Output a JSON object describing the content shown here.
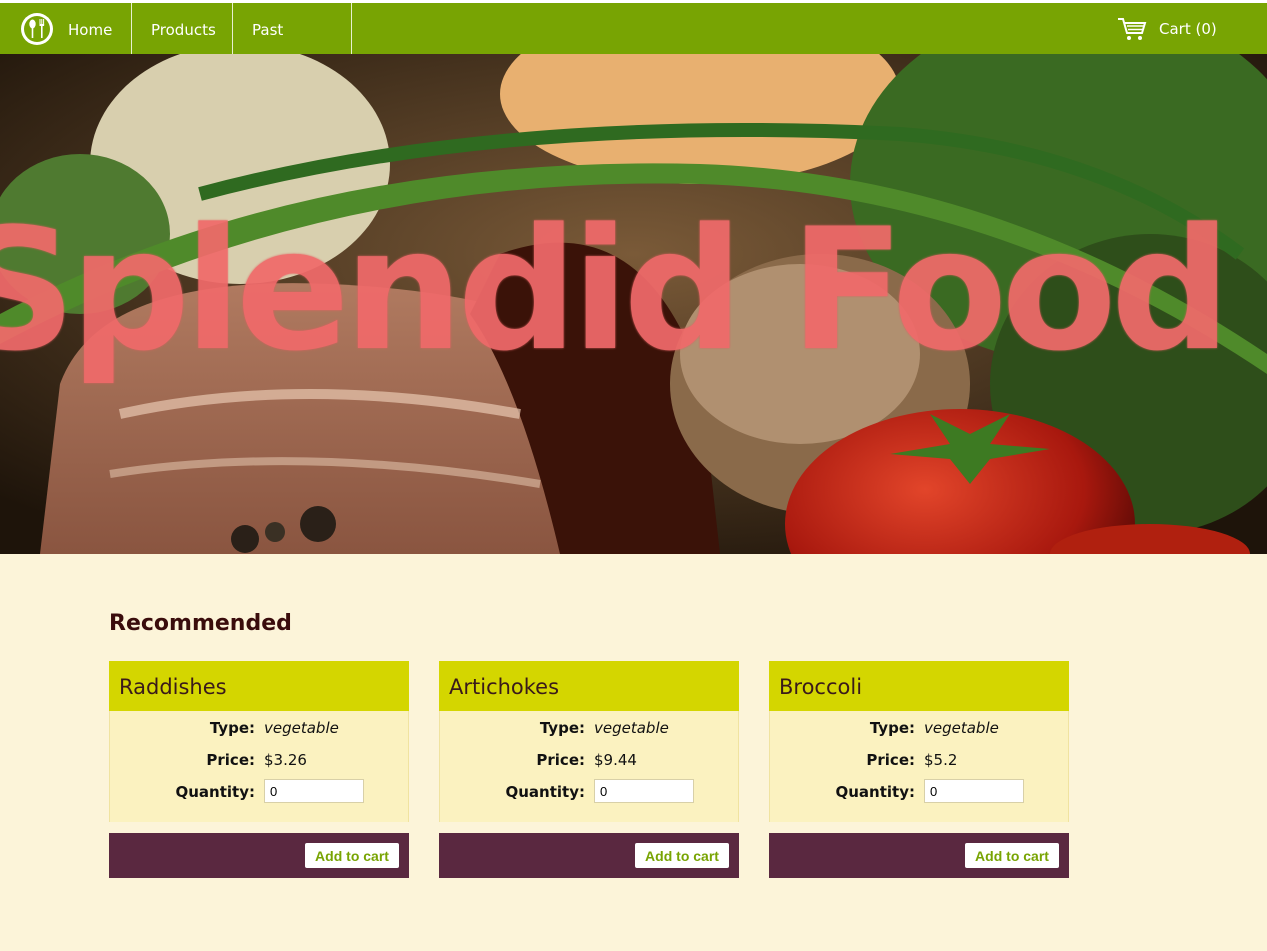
{
  "nav": {
    "home_label": "Home",
    "products_label": "Products",
    "orders_label": "Past Orders",
    "cart_label": "Cart (0)"
  },
  "hero": {
    "title": "Splendid Food"
  },
  "recommended": {
    "title": "Recommended",
    "type_label": "Type:",
    "price_label": "Price:",
    "quantity_label": "Quantity:",
    "add_label": "Add to cart",
    "products": [
      {
        "name": "Raddishes",
        "type": "vegetable",
        "price": "$3.26",
        "quantity": "0"
      },
      {
        "name": "Artichokes",
        "type": "vegetable",
        "price": "$9.44",
        "quantity": "0"
      },
      {
        "name": "Broccoli",
        "type": "vegetable",
        "price": "$5.2",
        "quantity": "0"
      }
    ]
  },
  "colors": {
    "nav_bg": "#78a403",
    "page_bg": "#fcf4d9",
    "card_header": "#d4d600",
    "card_footer": "#5a2840",
    "hero_text": "#f06a6a"
  }
}
